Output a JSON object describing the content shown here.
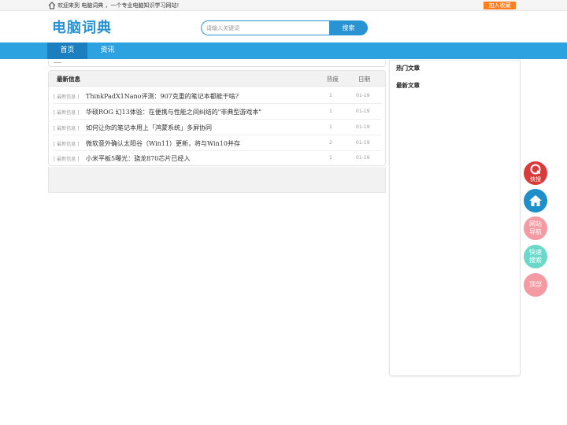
{
  "topbar": {
    "welcome": "欢迎来到 电脑词典 ，一个专业电脑知识学习网站!",
    "favorite": "加入收藏"
  },
  "header": {
    "logo": "电脑词典",
    "search_placeholder": "请输入关键词",
    "search_button": "搜索"
  },
  "nav": {
    "items": [
      {
        "label": "首页",
        "active": true
      },
      {
        "label": "资讯",
        "active": false
      }
    ]
  },
  "list": {
    "title": "最新信息",
    "col_hot": "热度",
    "col_date": "日期",
    "rows": [
      {
        "category": "[ 最新信息 ]",
        "title": "ThinkPadX1Nano评测：907克重的笔记本都能干啥?",
        "hot": "1",
        "date": "01-19"
      },
      {
        "category": "[ 最新信息 ]",
        "title": "华硕ROG 幻13体验：在便携与性能之间纠结的\"非典型游戏本\"",
        "hot": "1",
        "date": "01-19"
      },
      {
        "category": "[ 最新信息 ]",
        "title": "如何让你的笔记本用上「鸿蒙系统」多屏协同",
        "hot": "1",
        "date": "01-19"
      },
      {
        "category": "[ 最新信息 ]",
        "title": "微软意外确认太阳谷（Win11）更新，将与Win10并存",
        "hot": "2",
        "date": "01-19"
      },
      {
        "category": "[ 最新信息 ]",
        "title": "小米平板5曝光：骁龙870芯片已经入",
        "hot": "1",
        "date": "01-19"
      }
    ]
  },
  "sidebar": {
    "hot_articles": "热门文章",
    "latest_articles": "最新文章"
  },
  "floating": {
    "search": "快搜",
    "nav": [
      "网站",
      "导航"
    ],
    "quick_search": [
      "快速",
      "搜索"
    ],
    "top": "顶部"
  },
  "colors": {
    "brand_blue": "#2a93d4",
    "nav_blue": "#2da2e0",
    "nav_active": "#1b7fbf",
    "favorite_orange": "#ff7f1f"
  }
}
